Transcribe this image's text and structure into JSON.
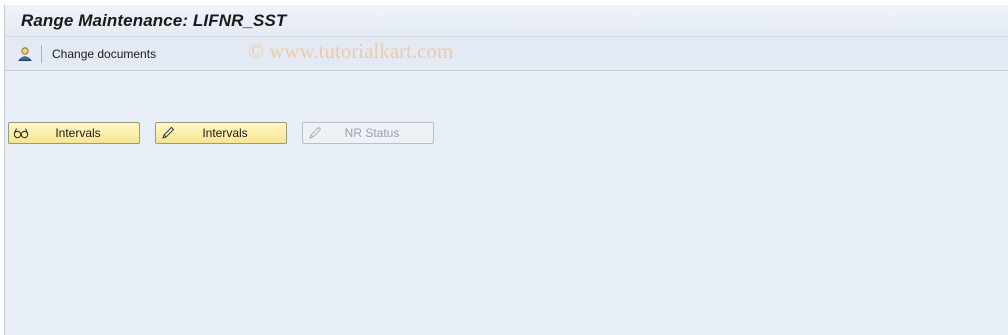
{
  "window": {
    "title": "Range Maintenance: LIFNR_SST"
  },
  "toolbar": {
    "user_icon": "user-icon",
    "change_documents_label": "Change documents"
  },
  "watermark": "© www.tutorialkart.com",
  "buttons": [
    {
      "label": "Intervals",
      "icon": "glasses-icon",
      "enabled": true
    },
    {
      "label": "Intervals",
      "icon": "pencil-icon",
      "enabled": true
    },
    {
      "label": "NR Status",
      "icon": "pencil-icon",
      "enabled": false
    }
  ],
  "colors": {
    "background": "#e8eef6",
    "button": "#f7e68e",
    "watermark": "#f0c9a6"
  }
}
